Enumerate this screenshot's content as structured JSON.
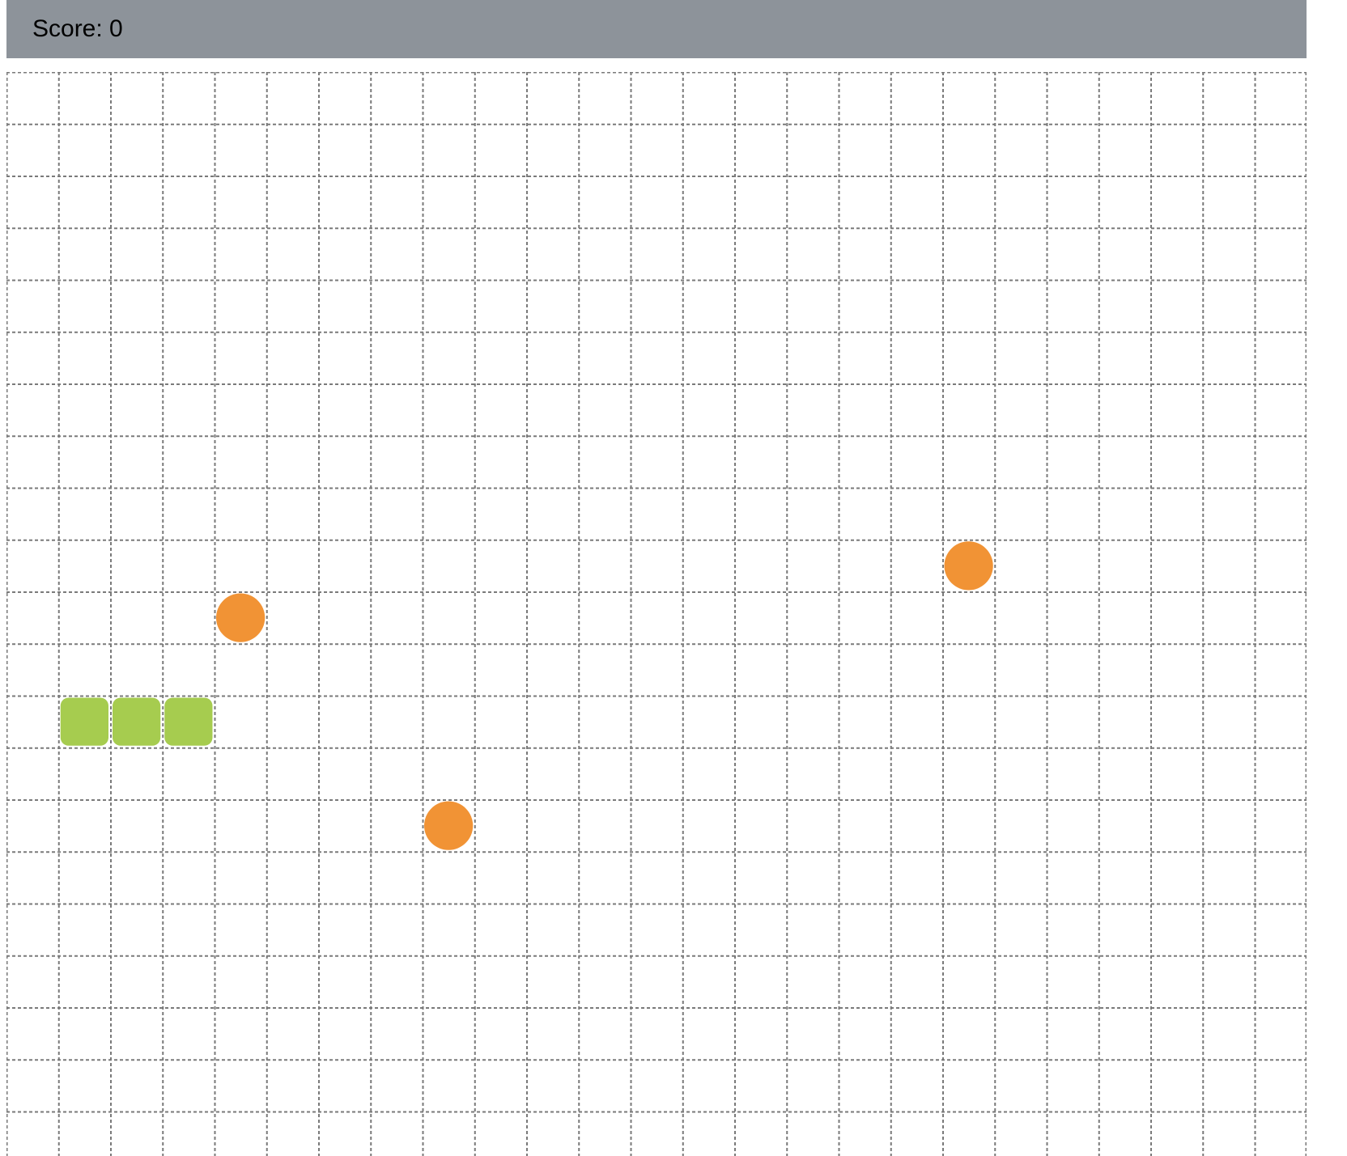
{
  "header": {
    "score_text": "Score: 0"
  },
  "game": {
    "grid": {
      "columns": 25,
      "rows": 22
    },
    "snake": {
      "color": "#a6cc4f",
      "segments": [
        {
          "col": 1,
          "row": 12
        },
        {
          "col": 2,
          "row": 12
        },
        {
          "col": 3,
          "row": 12
        }
      ]
    },
    "food": {
      "color": "#f19335",
      "items": [
        {
          "col": 4,
          "row": 10
        },
        {
          "col": 18,
          "row": 9
        },
        {
          "col": 8,
          "row": 14
        }
      ]
    },
    "grid_line_color": "#7a7a7a",
    "header_color": "#8d939a"
  }
}
